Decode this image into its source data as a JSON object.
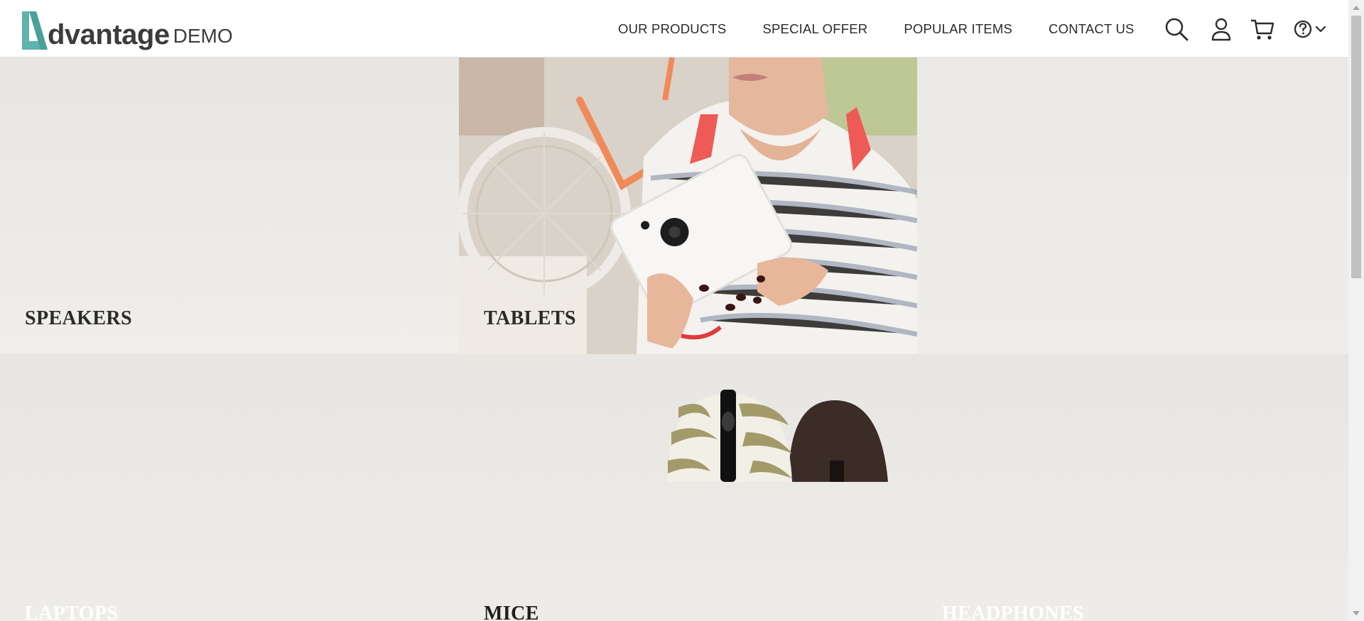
{
  "header": {
    "logo_word": "dvantage",
    "logo_suffix": "DEMO",
    "nav": [
      {
        "label": "OUR PRODUCTS"
      },
      {
        "label": "SPECIAL OFFER"
      },
      {
        "label": "POPULAR ITEMS"
      },
      {
        "label": "CONTACT US"
      }
    ],
    "icons": [
      "search-icon",
      "user-icon",
      "cart-icon",
      "help-icon",
      "chevron-down-icon"
    ]
  },
  "categories": {
    "speakers": "SPEAKERS",
    "tablets": "TABLETS",
    "laptops": "LAPTOPS",
    "mice": "MICE",
    "headphones": "HEADPHONES"
  },
  "colors": {
    "brand_teal": "#5fb3ac",
    "text_dark": "#2b2b2b",
    "page_bg": "#eceae6"
  }
}
